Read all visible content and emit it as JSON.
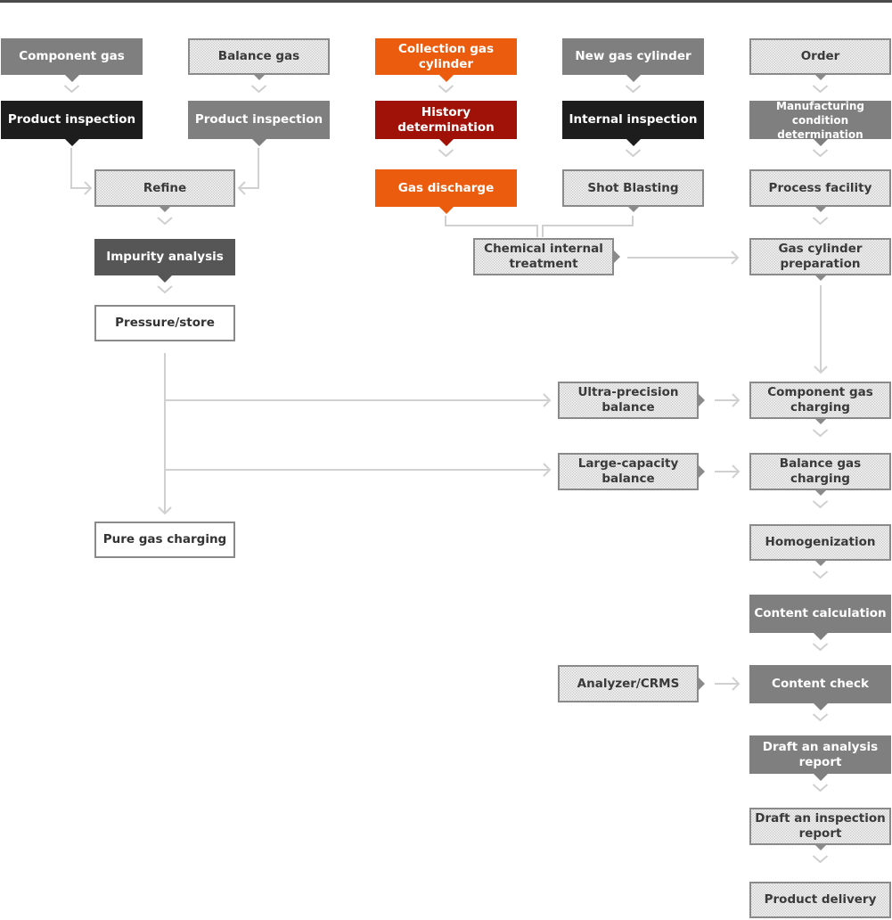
{
  "colors": {
    "orange": "#ec5c0e",
    "dark_red": "#a01208",
    "black": "#1d1d1d",
    "gray": "#7f7f7f",
    "dark_gray": "#565656",
    "connector": "#d0d0d0"
  },
  "nodes": {
    "component_gas": "Component gas",
    "product_inspection_1": "Product inspection",
    "balance_gas": "Balance gas",
    "product_inspection_2": "Product inspection",
    "refine": "Refine",
    "impurity_analysis": "Impurity analysis",
    "pressure_store": "Pressure/store",
    "pure_gas_charging": "Pure gas charging",
    "collection_gas_cylinder": "Collection gas cylinder",
    "history_determination": "History determination",
    "gas_discharge": "Gas discharge",
    "new_gas_cylinder": "New gas cylinder",
    "internal_inspection": "Internal inspection",
    "shot_blasting": "Shot Blasting",
    "chemical_internal_treatment": "Chemical internal treatment",
    "order": "Order",
    "manufacturing_condition_determination": "Manufacturing condition determination",
    "process_facility": "Process facility",
    "gas_cylinder_preparation": "Gas cylinder preparation",
    "ultra_precision_balance": "Ultra-precision balance",
    "large_capacity_balance": "Large-capacity balance",
    "component_gas_charging": "Component gas charging",
    "balance_gas_charging": "Balance gas charging",
    "homogenization": "Homogenization",
    "content_calculation": "Content calculation",
    "analyzer_crms": "Analyzer/CRMS",
    "content_check": "Content check",
    "draft_analysis_report": "Draft an analysis report",
    "draft_inspection_report": "Draft an inspection report",
    "product_delivery": "Product delivery"
  }
}
